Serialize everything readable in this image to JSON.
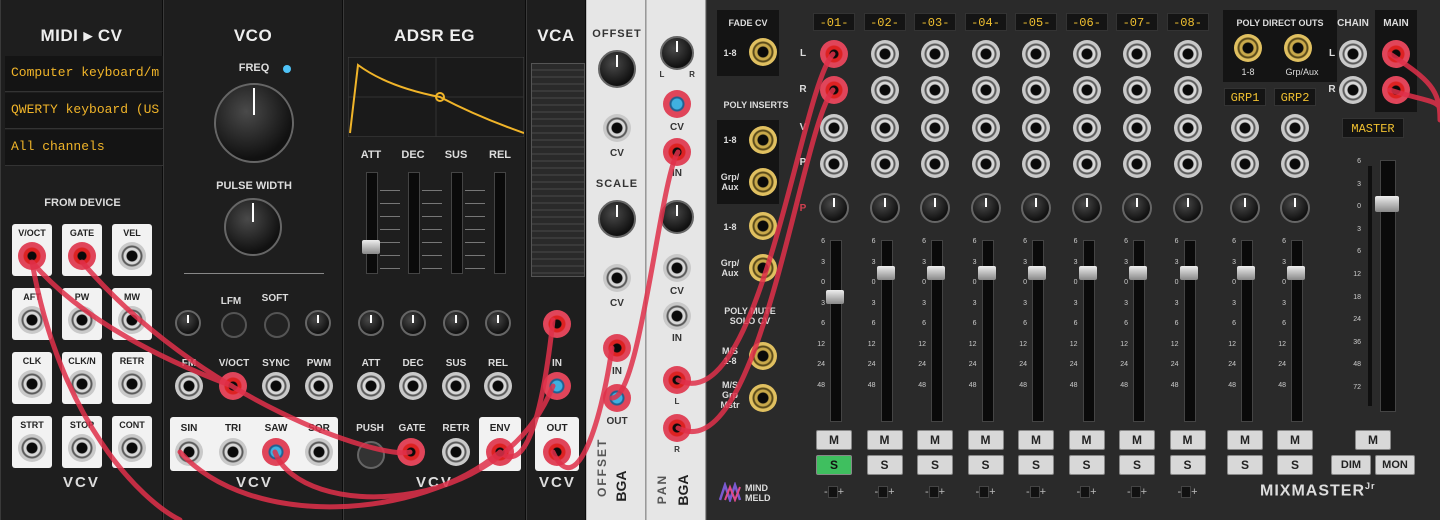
{
  "midi": {
    "title": "MIDI ▸ CV",
    "displays": [
      "Computer keyboard/m",
      "QWERTY keyboard (US",
      "All channels"
    ],
    "section": "FROM DEVICE",
    "jacks": [
      "V/OCT",
      "GATE",
      "VEL",
      "AFT",
      "PW",
      "MW",
      "CLK",
      "CLK/N",
      "RETR",
      "STRT",
      "STOP",
      "CONT"
    ],
    "brand": "VCV"
  },
  "vco": {
    "title": "VCO",
    "freq_label": "FREQ",
    "pw_label": "PULSE WIDTH",
    "lfm": "LFM",
    "soft": "SOFT",
    "inputs": [
      "FM",
      "V/OCT",
      "SYNC",
      "PWM"
    ],
    "outputs": [
      "SIN",
      "TRI",
      "SAW",
      "SQR"
    ],
    "brand": "VCV"
  },
  "adsr": {
    "title": "ADSR EG",
    "sliders": [
      "ATT",
      "DEC",
      "SUS",
      "REL"
    ],
    "cv": [
      "ATT",
      "DEC",
      "SUS",
      "REL"
    ],
    "push": "PUSH",
    "gate": "GATE",
    "retr": "RETR",
    "env": "ENV",
    "brand": "VCV"
  },
  "vca": {
    "title": "VCA",
    "in": "IN",
    "out": "OUT",
    "brand": "VCV"
  },
  "offset": {
    "offset_label": "OFFSET",
    "scale_label": "SCALE",
    "cv": "CV",
    "in": "IN",
    "out": "OUT",
    "side": "OFFSET",
    "brand": "BGA",
    "zero": "0"
  },
  "pan": {
    "l": "L",
    "r": "R",
    "cv": "CV",
    "in": "IN",
    "side": "PAN",
    "brand": "BGA"
  },
  "mixer": {
    "fade_cv": "FADE CV",
    "fade_range": "1-8",
    "poly_inserts": "POLY INSERTS",
    "ins1": "1-8",
    "ins2": "Grp/\nAux",
    "ins3": "1-8",
    "ins4": "Grp/\nAux",
    "poly_mute": "POLY MUTE\nSOLO CV",
    "ms1": "M/S\n1-8",
    "ms2": "M/S\nGrp\nMstr",
    "row_labels": [
      "L",
      "R",
      "V",
      "P",
      "P"
    ],
    "channels": [
      "-01-",
      "-02-",
      "-03-",
      "-04-",
      "-05-",
      "-06-",
      "-07-",
      "-08-"
    ],
    "groups": [
      "GRP1",
      "GRP2"
    ],
    "direct_outs": "POLY DIRECT OUTS",
    "direct_1": "1-8",
    "direct_2": "Grp/Aux",
    "chain": "CHAIN",
    "main": "MAIN",
    "master": "MASTER",
    "m": "M",
    "s": "S",
    "dim": "DIM",
    "mon": "MON",
    "scale": [
      "6",
      "3",
      "0",
      "3",
      "6",
      "12",
      "24",
      "48"
    ],
    "master_scale": [
      "6",
      "3",
      "0",
      "3",
      "6",
      "12",
      "18",
      "24",
      "36",
      "48",
      "72"
    ],
    "brand": "MIXMASTER",
    "brand_sub": "Jr",
    "meld": "MIND\nMELD"
  },
  "colors": {
    "cable": "#e0304a",
    "lcd_text": "#f0b429",
    "solo_on": "#3fbf5f"
  }
}
